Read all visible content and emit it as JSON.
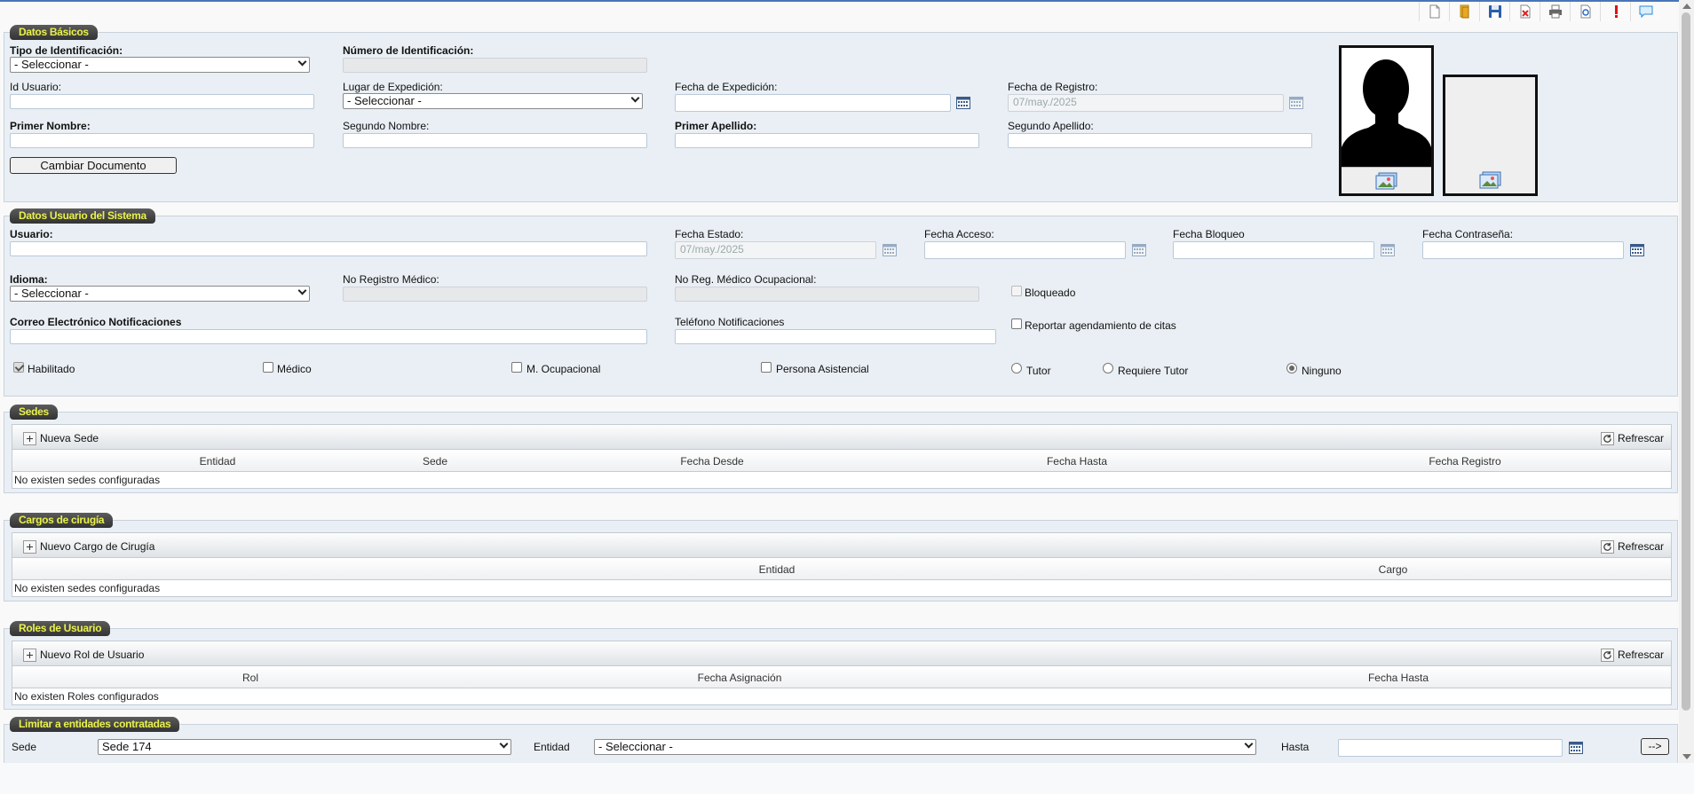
{
  "toolbar": {
    "icons": [
      "new-document-icon",
      "open-folder-icon",
      "save-icon",
      "delete-icon",
      "print-icon",
      "preview-icon",
      "alert-icon",
      "chat-icon"
    ]
  },
  "datos_basicos": {
    "title": "Datos Básicos",
    "tipo_identificacion": {
      "label": "Tipo de Identificación:",
      "value": "- Seleccionar -"
    },
    "numero_identificacion": {
      "label": "Número de Identificación:",
      "value": ""
    },
    "id_usuario": {
      "label": "Id Usuario:",
      "value": ""
    },
    "lugar_expedicion": {
      "label": "Lugar de Expedición:",
      "value": "- Seleccionar -"
    },
    "fecha_expedicion": {
      "label": "Fecha de Expedición:",
      "value": ""
    },
    "fecha_registro": {
      "label": "Fecha de Registro:",
      "value": "07/may./2025"
    },
    "primer_nombre": {
      "label": "Primer Nombre:",
      "value": ""
    },
    "segundo_nombre": {
      "label": "Segundo Nombre:",
      "value": ""
    },
    "primer_apellido": {
      "label": "Primer Apellido:",
      "value": ""
    },
    "segundo_apellido": {
      "label": "Segundo Apellido:",
      "value": ""
    },
    "cambiar_documento": "Cambiar Documento"
  },
  "datos_usuario": {
    "title": "Datos Usuario del Sistema",
    "usuario": {
      "label": "Usuario:",
      "value": ""
    },
    "fecha_estado": {
      "label": "Fecha Estado:",
      "value": "07/may./2025"
    },
    "fecha_acceso": {
      "label": "Fecha Acceso:",
      "value": ""
    },
    "fecha_bloqueo": {
      "label": "Fecha Bloqueo",
      "value": ""
    },
    "fecha_contrasena": {
      "label": "Fecha Contraseña:",
      "value": ""
    },
    "idioma": {
      "label": "Idioma:",
      "value": "- Seleccionar -"
    },
    "no_registro_medico": {
      "label": "No Registro Médico:",
      "value": ""
    },
    "no_reg_medico_ocupacional": {
      "label": "No Reg. Médico Ocupacional:",
      "value": ""
    },
    "bloqueado": {
      "label": "Bloqueado",
      "checked": false
    },
    "correo": {
      "label": "Correo Electrónico Notificaciones",
      "value": ""
    },
    "telefono": {
      "label": "Teléfono Notificaciones",
      "value": ""
    },
    "reportar": {
      "label": "Reportar agendamiento de citas",
      "checked": false
    },
    "habilitado": {
      "label": "Habilitado",
      "checked": true
    },
    "medico": {
      "label": "Médico",
      "checked": false
    },
    "m_ocupacional": {
      "label": "M. Ocupacional",
      "checked": false
    },
    "persona_asistencial": {
      "label": "Persona Asistencial",
      "checked": false
    },
    "tutor": {
      "label": "Tutor",
      "selected": false
    },
    "requiere_tutor": {
      "label": "Requiere Tutor",
      "selected": false
    },
    "ninguno": {
      "label": "Ninguno",
      "selected": true
    }
  },
  "sedes": {
    "title": "Sedes",
    "add_label": "Nueva Sede",
    "refresh_label": "Refrescar",
    "columns": [
      "Entidad",
      "Sede",
      "Fecha Desde",
      "Fecha Hasta",
      "Fecha Registro"
    ],
    "empty": "No existen sedes configuradas"
  },
  "cargos": {
    "title": "Cargos de cirugía",
    "add_label": "Nuevo Cargo de Cirugía",
    "refresh_label": "Refrescar",
    "columns": [
      "Entidad",
      "Cargo"
    ],
    "empty": "No existen sedes configuradas"
  },
  "roles": {
    "title": "Roles de Usuario",
    "add_label": "Nuevo Rol de Usuario",
    "refresh_label": "Refrescar",
    "columns": [
      "Rol",
      "Fecha Asignación",
      "Fecha Hasta"
    ],
    "empty": "No existen Roles configurados"
  },
  "limitar": {
    "title": "Limitar a entidades contratadas",
    "sede_label": "Sede",
    "sede_value": "Sede 174",
    "entidad_label": "Entidad",
    "entidad_value": "- Seleccionar -",
    "hasta_label": "Hasta",
    "hasta_value": "",
    "go_label": "-->"
  }
}
